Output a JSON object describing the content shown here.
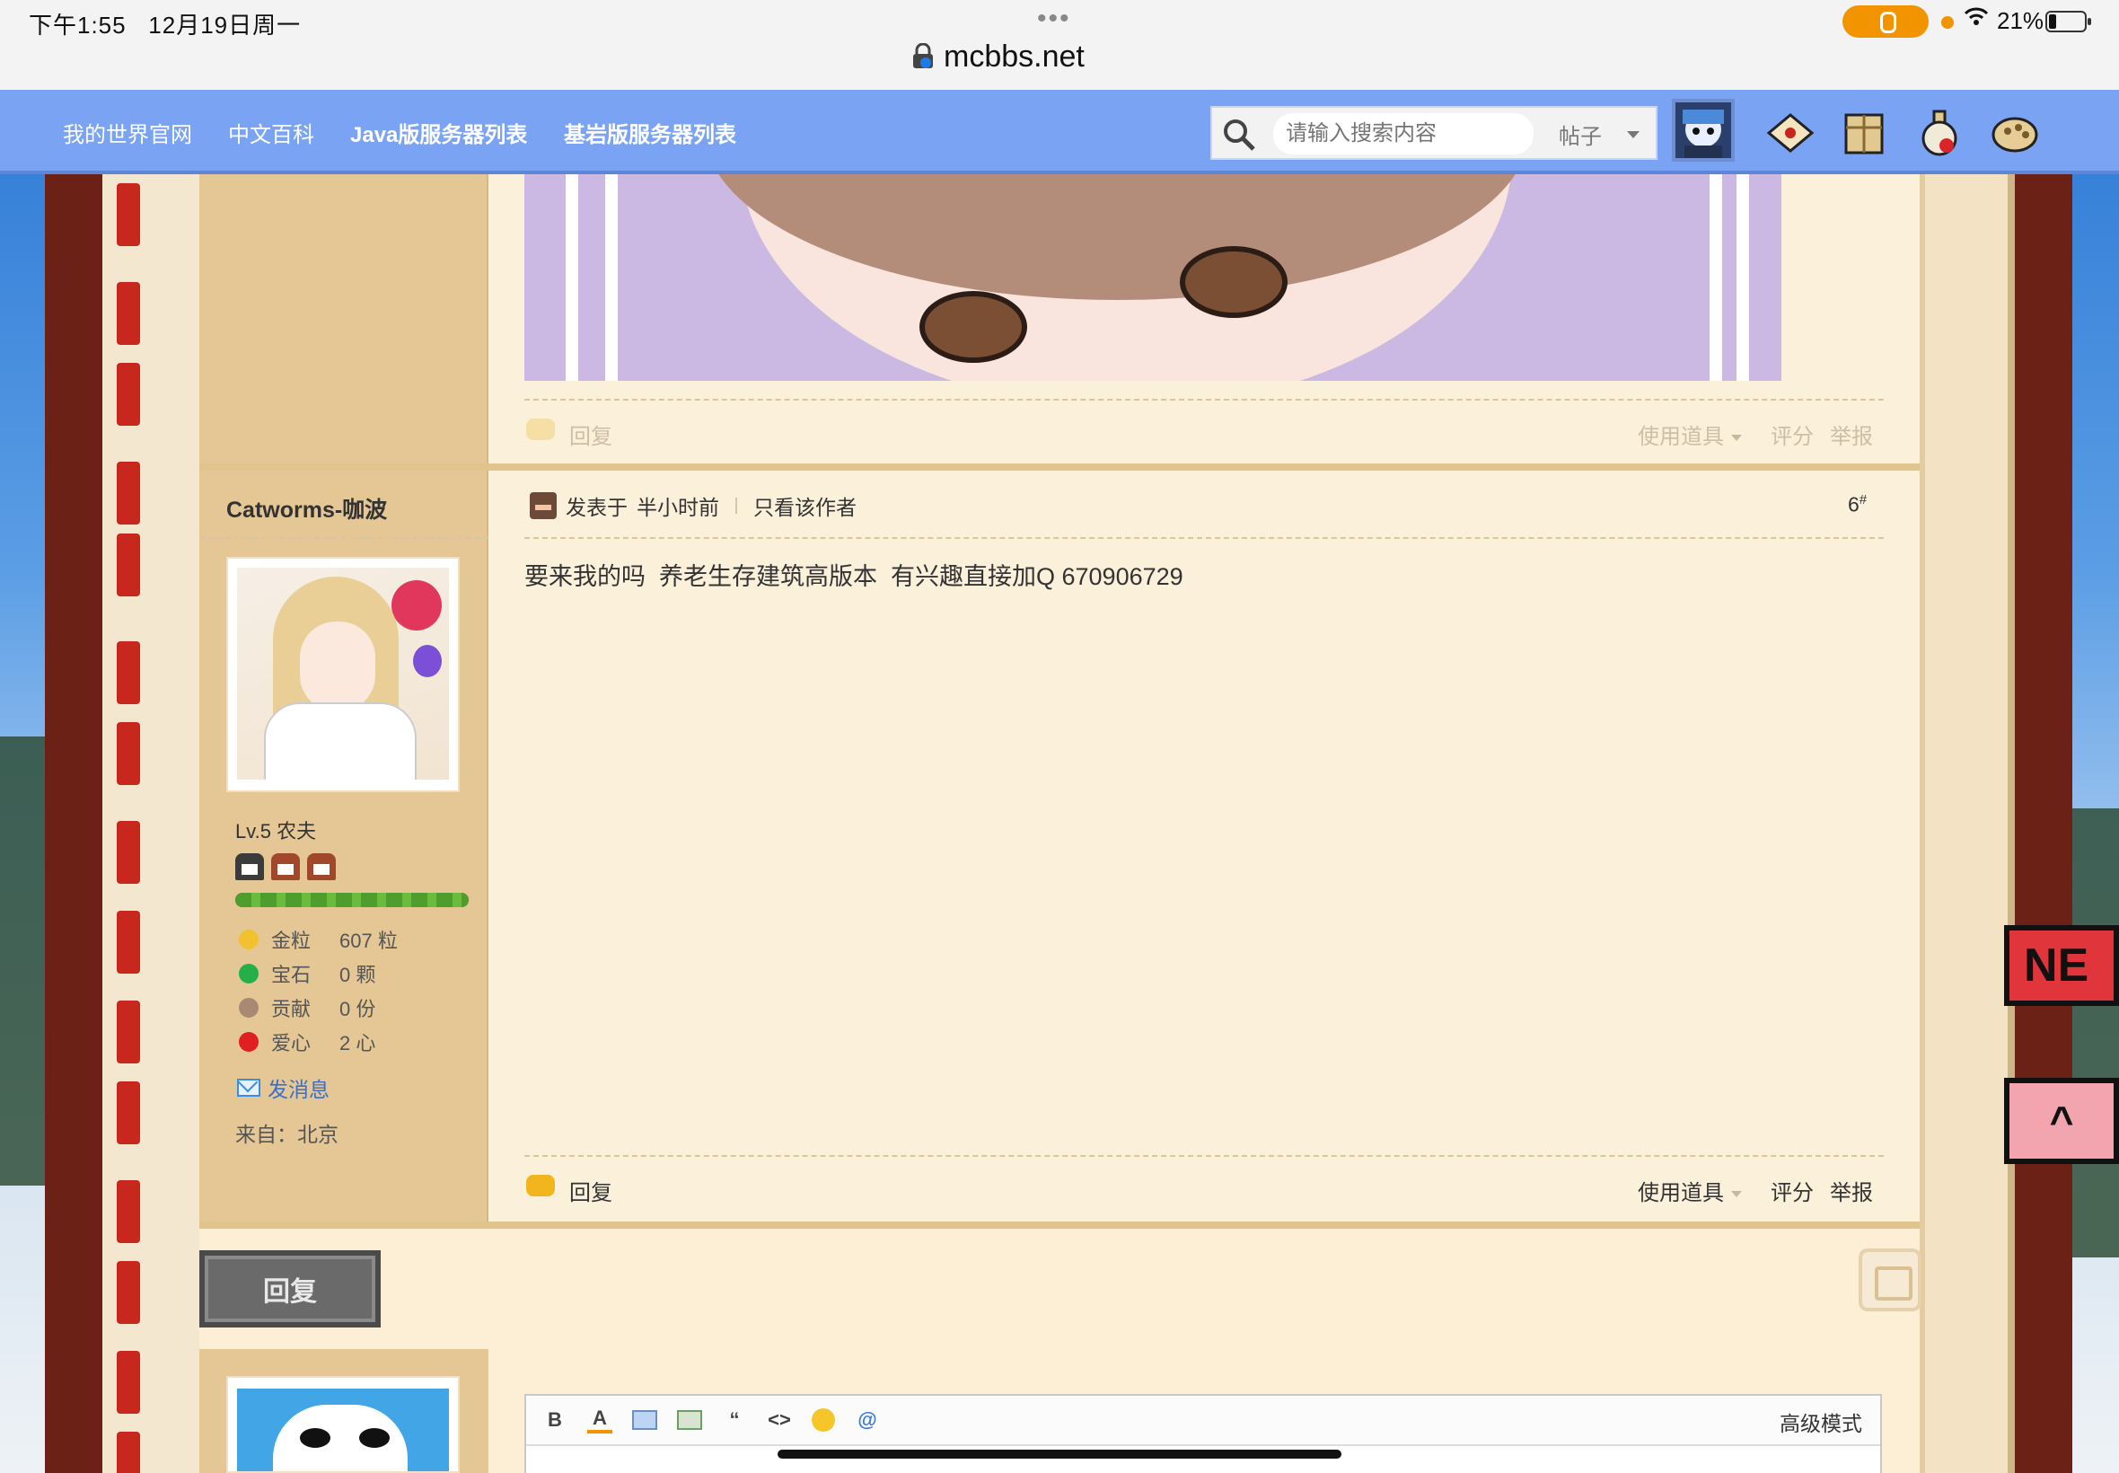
{
  "status_bar": {
    "time": "下午1:55",
    "date": "12月19日周一",
    "battery": "21%",
    "url": "mcbbs.net"
  },
  "nav": {
    "links": [
      "我的世界官网",
      "中文百科",
      "Java版服务器列表",
      "基岩版服务器列表"
    ],
    "search_placeholder": "请输入搜索内容",
    "search_type": "帖子"
  },
  "prev_post": {
    "actions": {
      "reply": "回复",
      "use_item": "使用道具",
      "rate": "评分",
      "report": "举报"
    }
  },
  "post": {
    "author": "Catworms-咖波",
    "level": "Lv.5 农夫",
    "xp_percent": 100,
    "stats": [
      {
        "label": "金粒",
        "value": "607 粒",
        "color": "#f2c12e"
      },
      {
        "label": "宝石",
        "value": "0 颗",
        "color": "#23b04a"
      },
      {
        "label": "贡献",
        "value": "0 份",
        "color": "#a88a74"
      },
      {
        "label": "爱心",
        "value": "2 心",
        "color": "#e02020"
      }
    ],
    "send_message": "发消息",
    "from": "来自：北京",
    "posted_prefix": "发表于",
    "posted_time": "半小时前",
    "author_only": "只看该作者",
    "floor": "6",
    "floor_mark": "#",
    "body": "要来我的吗  养老生存建筑高版本  有兴趣直接加Q 670906729",
    "actions": {
      "reply": "回复",
      "use_item": "使用道具",
      "rate": "评分",
      "report": "举报"
    }
  },
  "reply": {
    "button": "回复",
    "advanced_mode": "高级模式",
    "toolbar": [
      "B",
      "A",
      "image",
      "link",
      "“",
      "<>",
      "emoji",
      "@"
    ]
  },
  "badges": {
    "right_top": "NE",
    "right_bottom": "^"
  },
  "colors": {
    "nav_bg": "#7ba3f3",
    "frame_dark": "#6b2116",
    "sidebar": "#e5c796",
    "content": "#fbf0da",
    "accent_yellow": "#f2b51e"
  }
}
